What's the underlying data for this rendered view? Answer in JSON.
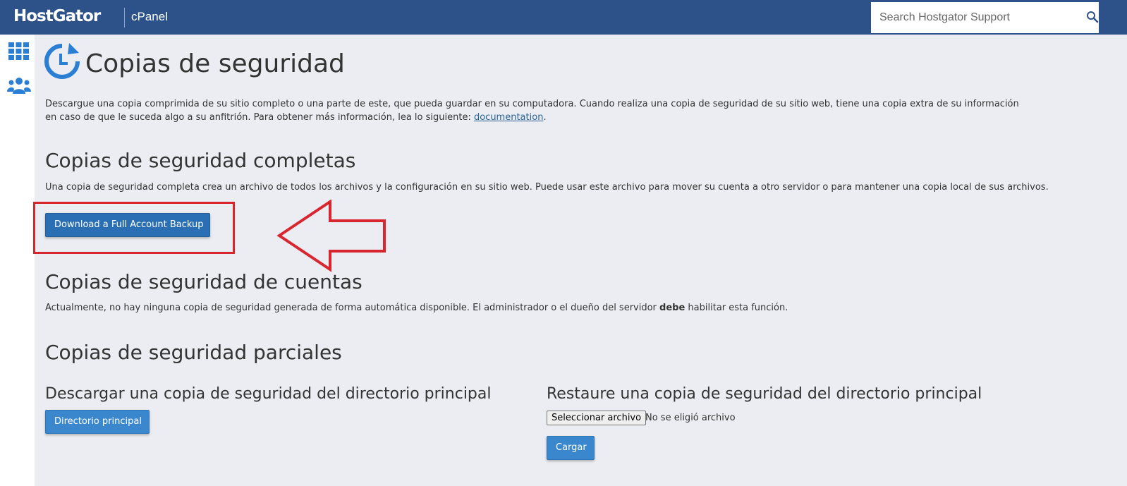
{
  "header": {
    "brand": "HostGator",
    "product": "cPanel",
    "search_placeholder": "Search Hostgator Support"
  },
  "page": {
    "title": "Copias de seguridad",
    "description": "Descargue una copia comprimida de su sitio completo o una parte de este, que pueda guardar en su computadora. Cuando realiza una copia de seguridad de su sitio web, tiene una copia extra de su información en caso de que le suceda algo a su anfitrión. Para obtener más información, lea lo siguiente: ",
    "doc_link": "documentation",
    "doc_suffix": "."
  },
  "full_backup": {
    "heading": "Copias de seguridad completas",
    "text": "Una copia de seguridad completa crea un archivo de todos los archivos y la configuración en su sitio web. Puede usar este archivo para mover su cuenta a otro servidor o para mantener una copia local de sus archivos.",
    "button": "Download a Full Account Backup"
  },
  "account_backups": {
    "heading": "Copias de seguridad de cuentas",
    "text_before": "Actualmente, no hay ninguna copia de seguridad generada de forma automática disponible. El administrador o el dueño del servidor ",
    "text_bold": "debe",
    "text_after": " habilitar esta función."
  },
  "partial": {
    "heading": "Copias de seguridad parciales",
    "download_heading": "Descargar una copia de seguridad del directorio principal",
    "download_button": "Directorio principal",
    "restore_heading": "Restaure una copia de seguridad del directorio principal",
    "file_button": "Seleccionar archivo",
    "file_status": "No se eligió archivo",
    "upload_button": "Cargar"
  },
  "colors": {
    "header_bg": "#2c5289",
    "button": "#2a6fb3",
    "highlight": "#d7262e",
    "icon": "#2a7fd4"
  }
}
